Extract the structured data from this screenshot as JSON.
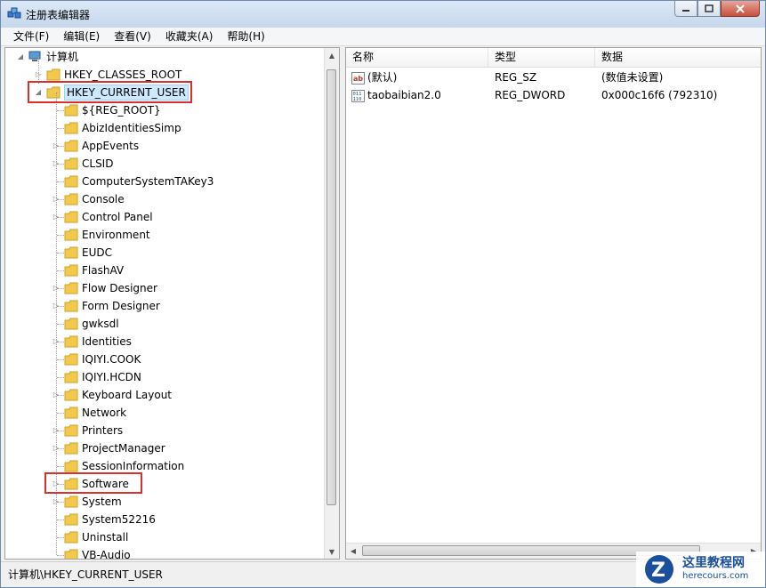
{
  "window": {
    "title": "注册表编辑器"
  },
  "menu": [
    "文件(F)",
    "编辑(E)",
    "查看(V)",
    "收藏夹(A)",
    "帮助(H)"
  ],
  "tree": {
    "root": "计算机",
    "top_keys": [
      "HKEY_CLASSES_ROOT",
      "HKEY_CURRENT_USER"
    ],
    "subkeys": [
      "${REG_ROOT}",
      "AbizIdentitiesSimp",
      "AppEvents",
      "CLSID",
      "ComputerSystemTAKey3",
      "Console",
      "Control Panel",
      "Environment",
      "EUDC",
      "FlashAV",
      "Flow Designer",
      "Form Designer",
      "gwksdl",
      "Identities",
      "IQIYI.COOK",
      "IQIYI.HCDN",
      "Keyboard Layout",
      "Network",
      "Printers",
      "ProjectManager",
      "SessionInformation",
      "Software",
      "System",
      "System52216",
      "Uninstall",
      "VB-Audio"
    ]
  },
  "columns": {
    "name": "名称",
    "type": "类型",
    "data": "数据"
  },
  "values": [
    {
      "name": "(默认)",
      "type": "REG_SZ",
      "data": "(数值未设置)",
      "icon": "string-value-icon"
    },
    {
      "name": "taobaibian2.0",
      "type": "REG_DWORD",
      "data": "0x000c16f6 (792310)",
      "icon": "binary-value-icon"
    }
  ],
  "status": "计算机\\HKEY_CURRENT_USER",
  "watermark": {
    "main": "这里教程网",
    "sub": "herecours.com"
  },
  "colors": {
    "highlight": "#d9302c",
    "selection": "#cde8ff",
    "folder": "#f2c94c"
  }
}
